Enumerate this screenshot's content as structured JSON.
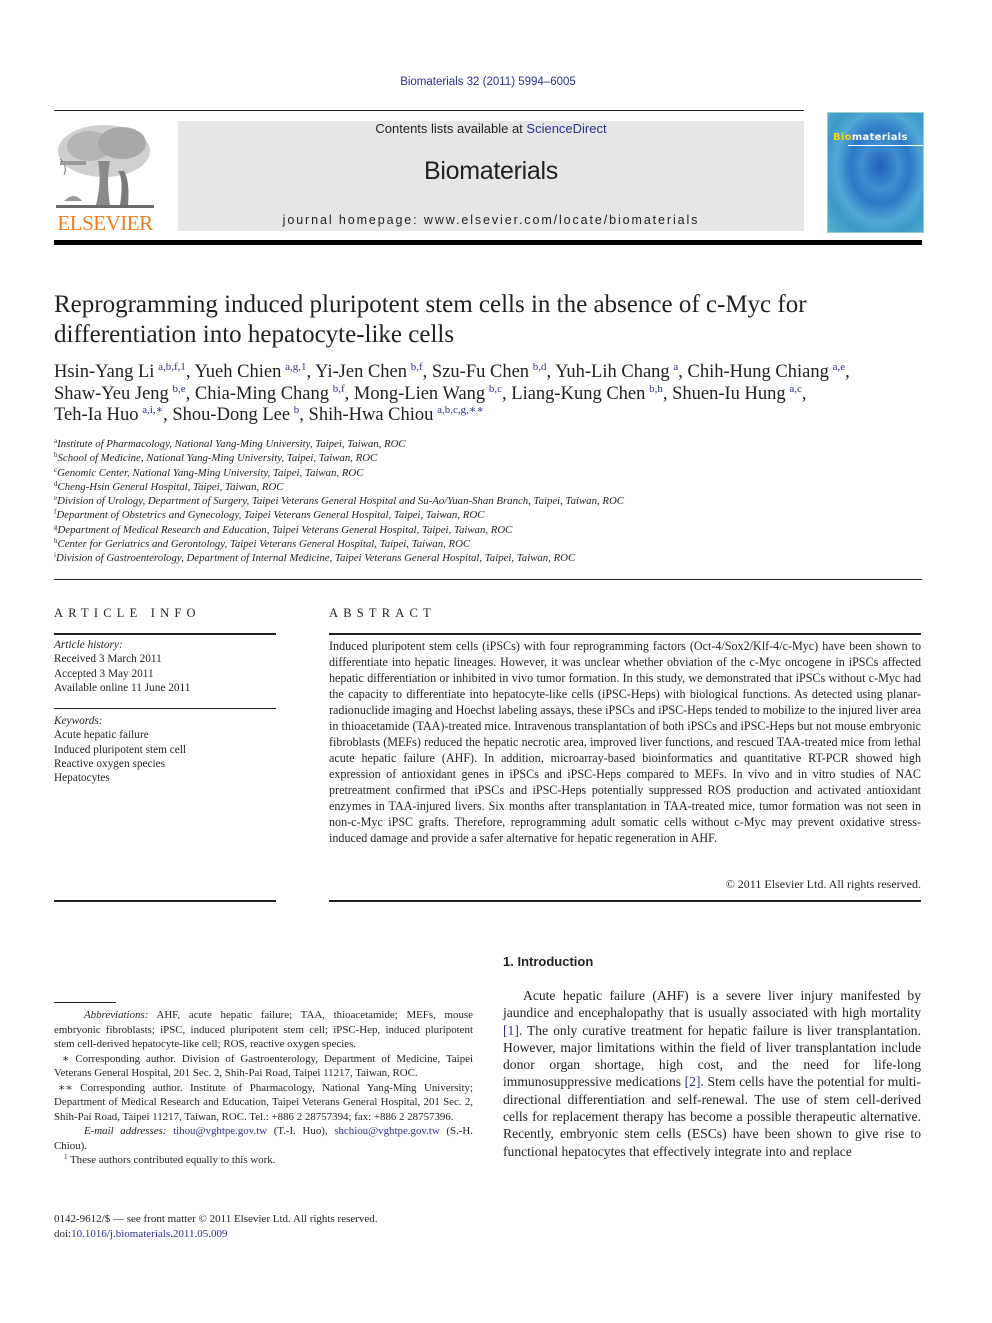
{
  "header": {
    "citation": "Biomaterials 32 (2011) 5994–6005",
    "contents_prefix": "Contents lists available at ",
    "contents_link": "ScienceDirect",
    "journal_name": "Biomaterials",
    "homepage": "journal homepage: www.elsevier.com/locate/biomaterials",
    "publisher_logo_text": "ELSEVIER",
    "cover_title_highlight": "Bio",
    "cover_title_rest": "materials",
    "colors": {
      "publisher_orange": "#f47b20",
      "link_blue": "#2e3092",
      "masthead_gray": "#e6e6e6"
    }
  },
  "article": {
    "title": "Reprogramming induced pluripotent stem cells in the absence of c-Myc for differentiation into hepatocyte-like cells",
    "authors": [
      {
        "name": "Hsin-Yang Li",
        "aff": "a,b,f,1"
      },
      {
        "name": "Yueh Chien",
        "aff": "a,g,1"
      },
      {
        "name": "Yi-Jen Chen",
        "aff": "b,f"
      },
      {
        "name": "Szu-Fu Chen",
        "aff": "b,d"
      },
      {
        "name": "Yuh-Lih Chang",
        "aff": "a"
      },
      {
        "name": "Chih-Hung Chiang",
        "aff": "a,e"
      },
      {
        "name": "Shaw-Yeu Jeng",
        "aff": "b,e"
      },
      {
        "name": "Chia-Ming Chang",
        "aff": "b,f"
      },
      {
        "name": "Mong-Lien Wang",
        "aff": "b,c"
      },
      {
        "name": "Liang-Kung Chen",
        "aff": "b,h"
      },
      {
        "name": "Shuen-Iu Hung",
        "aff": "a,c"
      },
      {
        "name": "Teh-Ia Huo",
        "aff": "a,i,∗"
      },
      {
        "name": "Shou-Dong Lee",
        "aff": "b"
      },
      {
        "name": "Shih-Hwa Chiou",
        "aff": "a,b,c,g,∗∗"
      }
    ],
    "affiliations": [
      {
        "key": "a",
        "text": "Institute of Pharmacology, National Yang-Ming University, Taipei, Taiwan, ROC"
      },
      {
        "key": "b",
        "text": "School of Medicine, National Yang-Ming University, Taipei, Taiwan, ROC"
      },
      {
        "key": "c",
        "text": "Genomic Center, National Yang-Ming University, Taipei, Taiwan, ROC"
      },
      {
        "key": "d",
        "text": "Cheng-Hsin General Hospital, Taipei, Taiwan, ROC"
      },
      {
        "key": "e",
        "text": "Division of Urology, Department of Surgery, Taipei Veterans General Hospital and Su-Ao/Yuan-Shan Branch, Taipei, Taiwan, ROC"
      },
      {
        "key": "f",
        "text": "Department of Obstetrics and Gynecology, Taipei Veterans General Hospital, Taipei, Taiwan, ROC"
      },
      {
        "key": "g",
        "text": "Department of Medical Research and Education, Taipei Veterans General Hospital, Taipei, Taiwan, ROC"
      },
      {
        "key": "h",
        "text": "Center for Geriatrics and Gerontology, Taipei Veterans General Hospital, Taipei, Taiwan, ROC"
      },
      {
        "key": "i",
        "text": "Division of Gastroenterology, Department of Internal Medicine, Taipei Veterans General Hospital, Taipei, Taiwan, ROC"
      }
    ]
  },
  "article_info": {
    "heading": "ARTICLE INFO",
    "history_label": "Article history:",
    "history": [
      "Received 3 March 2011",
      "Accepted 3 May 2011",
      "Available online 11 June 2011"
    ],
    "keywords_label": "Keywords:",
    "keywords": [
      "Acute hepatic failure",
      "Induced pluripotent stem cell",
      "Reactive oxygen species",
      "Hepatocytes"
    ]
  },
  "abstract": {
    "heading": "ABSTRACT",
    "text": "Induced pluripotent stem cells (iPSCs) with four reprogramming factors (Oct-4/Sox2/Klf-4/c-Myc) have been shown to differentiate into hepatic lineages. However, it was unclear whether obviation of the c-Myc oncogene in iPSCs affected hepatic differentiation or inhibited in vivo tumor formation. In this study, we demonstrated that iPSCs without c-Myc had the capacity to differentiate into hepatocyte-like cells (iPSC-Heps) with biological functions. As detected using planar-radionuclide imaging and Hoechst labeling assays, these iPSCs and iPSC-Heps tended to mobilize to the injured liver area in thioacetamide (TAA)-treated mice. Intravenous transplantation of both iPSCs and iPSC-Heps but not mouse embryonic fibroblasts (MEFs) reduced the hepatic necrotic area, improved liver functions, and rescued TAA-treated mice from lethal acute hepatic failure (AHF). In addition, microarray-based bioinformatics and quantitative RT-PCR showed high expression of antioxidant genes in iPSCs and iPSC-Heps compared to MEFs. In vivo and in vitro studies of NAC pretreatment confirmed that iPSCs and iPSC-Heps potentially suppressed ROS production and activated antioxidant enzymes in TAA-injured livers. Six months after transplantation in TAA-treated mice, tumor formation was not seen in non-c-Myc iPSC grafts. Therefore, reprogramming adult somatic cells without c-Myc may prevent oxidative stress-induced damage and provide a safer alternative for hepatic regeneration in AHF.",
    "copyright": "© 2011 Elsevier Ltd. All rights reserved."
  },
  "footnotes": {
    "abbrev_label": "Abbreviations:",
    "abbrev_text": " AHF, acute hepatic failure; TAA, thioacetamide; MEFs, mouse embryonic fibroblasts; iPSC, induced pluripotent stem cell; iPSC-Hep, induced pluripotent stem cell-derived hepatocyte-like cell; ROS, reactive oxygen species.",
    "corr1": "∗ Corresponding author. Division of Gastroenterology, Department of Medicine, Taipei Veterans General Hospital, 201 Sec. 2, Shih-Pai Road, Taipei 11217, Taiwan, ROC.",
    "corr2": "∗∗ Corresponding author. Institute of Pharmacology, National Yang-Ming University; Department of Medical Research and Education, Taipei Veterans General Hospital, 201 Sec. 2, Shih-Pai Road, Taipei 11217, Taiwan, ROC. Tel.: +886 2 28757394; fax: +886 2 28757396.",
    "email_label": "E-mail addresses:",
    "email1": "tihou@vghtpe.gov.tw",
    "email1_owner": " (T.-I. Huo), ",
    "email2": "shchiou@vghtpe.gov.tw",
    "email2_owner": " (S.-H. Chiou).",
    "equal_mark": "1",
    "equal_text": " These authors contributed equally to this work."
  },
  "front_matter": {
    "issn_line": "0142-9612/$ — see front matter © 2011 Elsevier Ltd. All rights reserved.",
    "doi_prefix": "doi:",
    "doi": "10.1016/j.biomaterials.2011.05.009"
  },
  "introduction": {
    "heading": "1.  Introduction",
    "p1_a": "Acute hepatic failure (AHF) is a severe liver injury manifested by jaundice and encephalopathy that is usually associated with high mortality ",
    "ref1": "[1]",
    "p1_b": ". The only curative treatment for hepatic failure is liver transplantation. However, major limitations within the field of liver transplantation include donor organ shortage, high cost, and the need for life-long immunosuppressive medications ",
    "ref2": "[2]",
    "p1_c": ". Stem cells have the potential for multi-directional differentiation and self-renewal. The use of stem cell-derived cells for replacement therapy has become a possible therapeutic alternative. Recently, embryonic stem cells (ESCs) have been shown to give rise to functional hepatocytes that effectively integrate into and replace"
  }
}
